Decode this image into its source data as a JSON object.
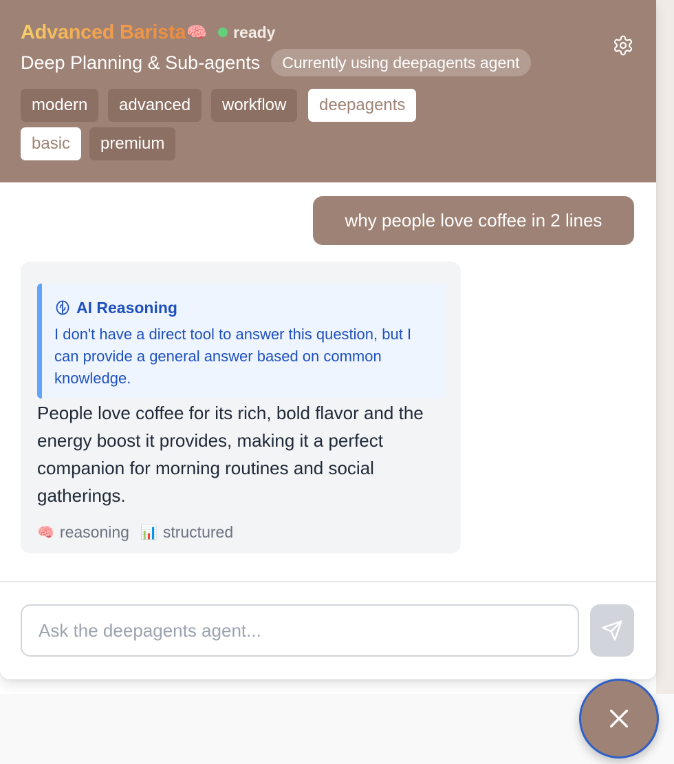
{
  "header": {
    "agent_name": "Advanced Barista",
    "agent_emoji": "🧠",
    "status": "ready",
    "subtitle": "Deep Planning & Sub-agents",
    "using_badge": "Currently using deepagents agent",
    "settings_icon": "gear-icon",
    "tags": [
      {
        "label": "modern",
        "active": false
      },
      {
        "label": "advanced",
        "active": false
      },
      {
        "label": "workflow",
        "active": false
      },
      {
        "label": "deepagents",
        "active": true
      },
      {
        "label": "basic",
        "active": true
      },
      {
        "label": "premium",
        "active": false
      }
    ]
  },
  "messages": {
    "user": "why people love coffee in 2 lines",
    "ai": {
      "reasoning_icon": "brain-icon",
      "reasoning_title": "AI Reasoning",
      "reasoning_text": "I don't have a direct tool to answer this question, but I can provide a general answer based on common knowledge.",
      "answer": "People love coffee for its rich, bold flavor and the energy boost it provides, making it a perfect companion for morning routines and social gatherings.",
      "meta": [
        {
          "emoji": "🧠",
          "label": "reasoning"
        },
        {
          "emoji": "📊",
          "label": "structured"
        }
      ]
    }
  },
  "input": {
    "placeholder": "Ask the deepagents agent...",
    "value": "",
    "send_icon": "send-icon"
  },
  "close_icon": "close-icon",
  "colors": {
    "header_bg": "#9e8275",
    "status_green": "#64d07c",
    "reasoning_blue": "#1e50bd",
    "reasoning_border": "#60a5fa"
  }
}
